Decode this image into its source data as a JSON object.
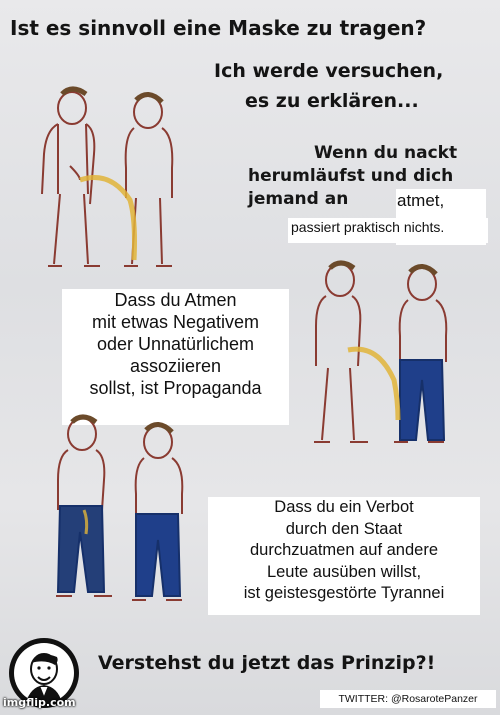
{
  "header": {
    "title": "Ist es sinnvoll eine Maske zu tragen?",
    "subtitle_line1": "Ich werde versuchen,",
    "subtitle_line2": "es zu erklären..."
  },
  "panel1": {
    "line1": "Wenn du nackt",
    "line2": "herumläufst und dich",
    "line3": "jemand an",
    "line3_overlay": "atmet,",
    "line4": "passiert praktisch nichts."
  },
  "panel2": {
    "lines": [
      "Dass du Atmen",
      "mit etwas Negativem",
      "oder Unnatürlichem",
      "assoziieren",
      "sollst, ist Propaganda"
    ]
  },
  "panel3": {
    "lines": [
      "Dass du ein Verbot",
      "durch den Staat",
      "durchzuatmen auf andere",
      "Leute ausüben willst,",
      "ist geistesgestörte Tyrannei"
    ]
  },
  "footer": {
    "question": "Verstehst du jetzt das Prinzip?!",
    "credit": "TWITTER: @RosarotePanzer",
    "watermark": "imgflip.com"
  },
  "colors": {
    "jeans": "#1f3f8a",
    "stream": "#e0b43a",
    "skin_line": "#8a3b32"
  }
}
